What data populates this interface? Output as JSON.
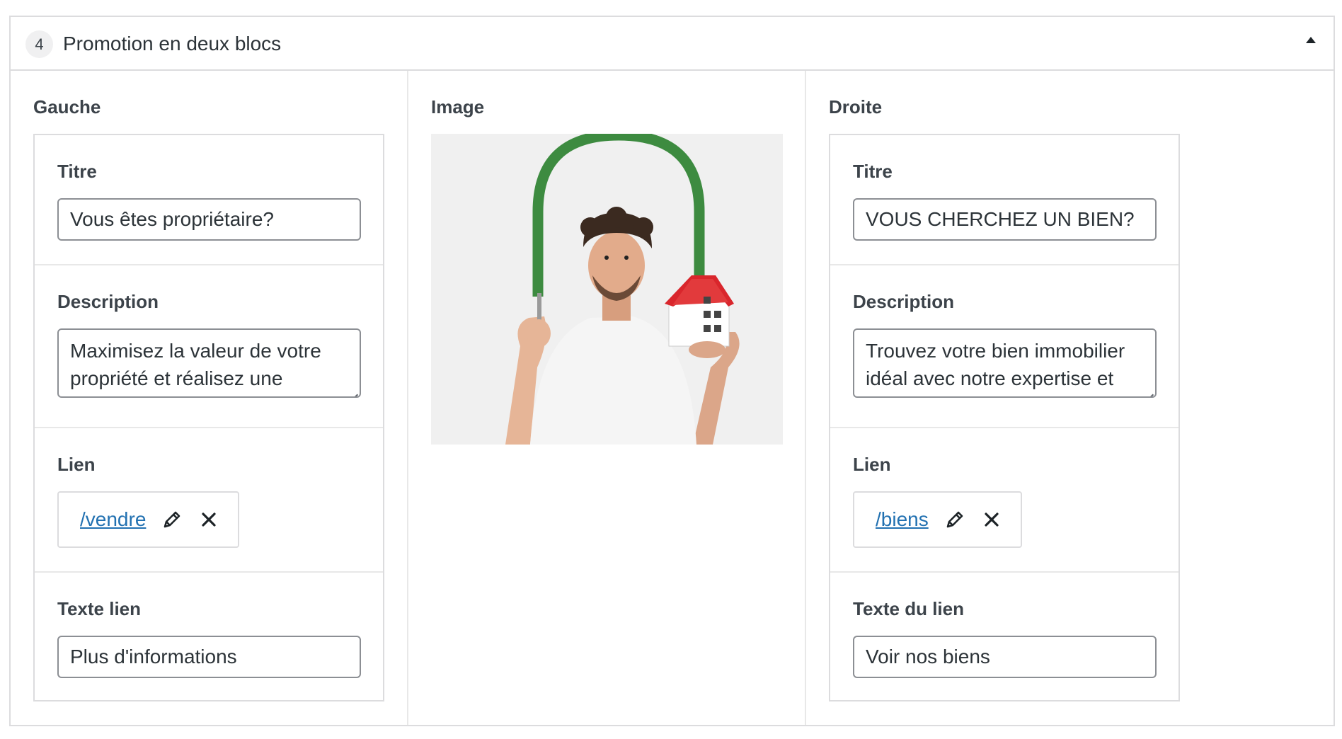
{
  "block": {
    "number": "4",
    "title": "Promotion en deux blocs"
  },
  "left": {
    "label": "Gauche",
    "title_label": "Titre",
    "title_value": "Vous êtes propriétaire?",
    "description_label": "Description",
    "description_value": "Maximisez la valeur de votre propriété et réalisez une",
    "link_label": "Lien",
    "link_url": "/vendre",
    "link_text_label": "Texte lien",
    "link_text_value": "Plus d'informations"
  },
  "middle": {
    "label": "Image"
  },
  "right": {
    "label": "Droite",
    "title_label": "Titre",
    "title_value": "VOUS CHERCHEZ UN BIEN?",
    "description_label": "Description",
    "description_value": "Trouvez votre bien immobilier idéal avec notre expertise et",
    "link_label": "Lien",
    "link_url": "/biens",
    "link_text_label": "Texte du lien",
    "link_text_value": "Voir nos biens"
  },
  "icons": [
    "pencil-icon",
    "close-icon",
    "collapse-arrow-icon"
  ],
  "colors": {
    "link": "#2271b1",
    "border": "#8c8f94",
    "arch": "#3d8b40",
    "roof": "#d9262c"
  }
}
